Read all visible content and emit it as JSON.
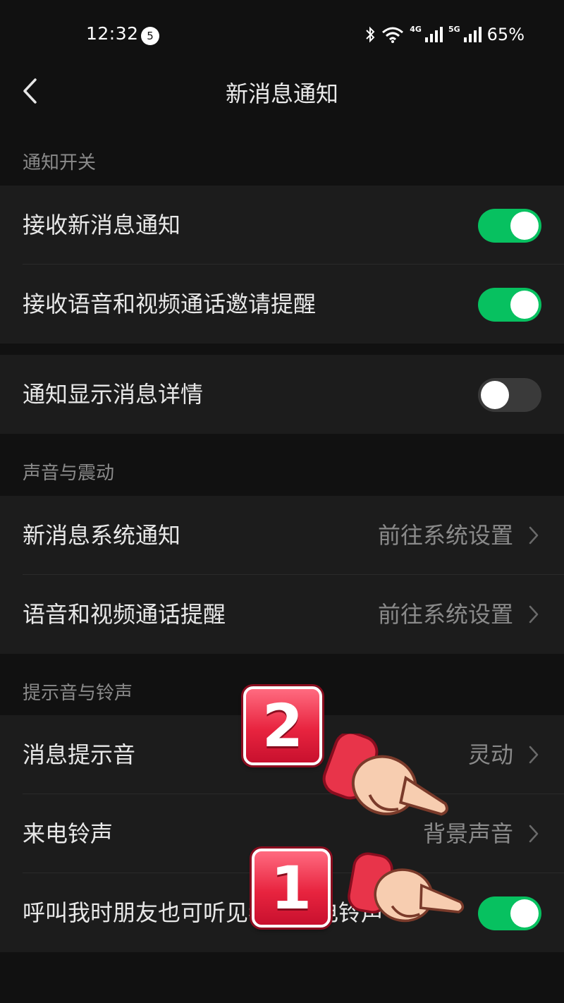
{
  "status_bar": {
    "time": "12:32",
    "notification_count": "5",
    "network1": "4G",
    "network2": "5G",
    "battery": "65%"
  },
  "header": {
    "title": "新消息通知"
  },
  "sections": {
    "notify_switch": {
      "header": "通知开关",
      "receive_new_msg": {
        "label": "接收新消息通知",
        "on": true
      },
      "receive_call_invite": {
        "label": "接收语音和视频通话邀请提醒",
        "on": true
      },
      "show_details": {
        "label": "通知显示消息详情",
        "on": false
      }
    },
    "sound_vibration": {
      "header": "声音与震动",
      "system_notify": {
        "label": "新消息系统通知",
        "value": "前往系统设置"
      },
      "call_reminder": {
        "label": "语音和视频通话提醒",
        "value": "前往系统设置"
      }
    },
    "tones": {
      "header": "提示音与铃声",
      "message_tone": {
        "label": "消息提示音",
        "value": "灵动"
      },
      "ringtone": {
        "label": "来电铃声",
        "value": "背景声音"
      },
      "friends_hear": {
        "label": "呼叫我时朋友也可听见我的来电铃声",
        "on": true
      }
    }
  },
  "overlays": {
    "badge1": "1",
    "badge2": "2"
  },
  "colors": {
    "toggle_on": "#07c160",
    "toggle_off": "#3a3a3a",
    "background": "#111111",
    "group_bg": "#1c1c1c"
  },
  "icons": {
    "back": "chevron-left-icon",
    "row_arrow": "chevron-right-icon",
    "bluetooth": "bluetooth-icon",
    "wifi": "wifi-icon",
    "signal": "signal-icon",
    "pointer": "pointing-hand-icon"
  }
}
